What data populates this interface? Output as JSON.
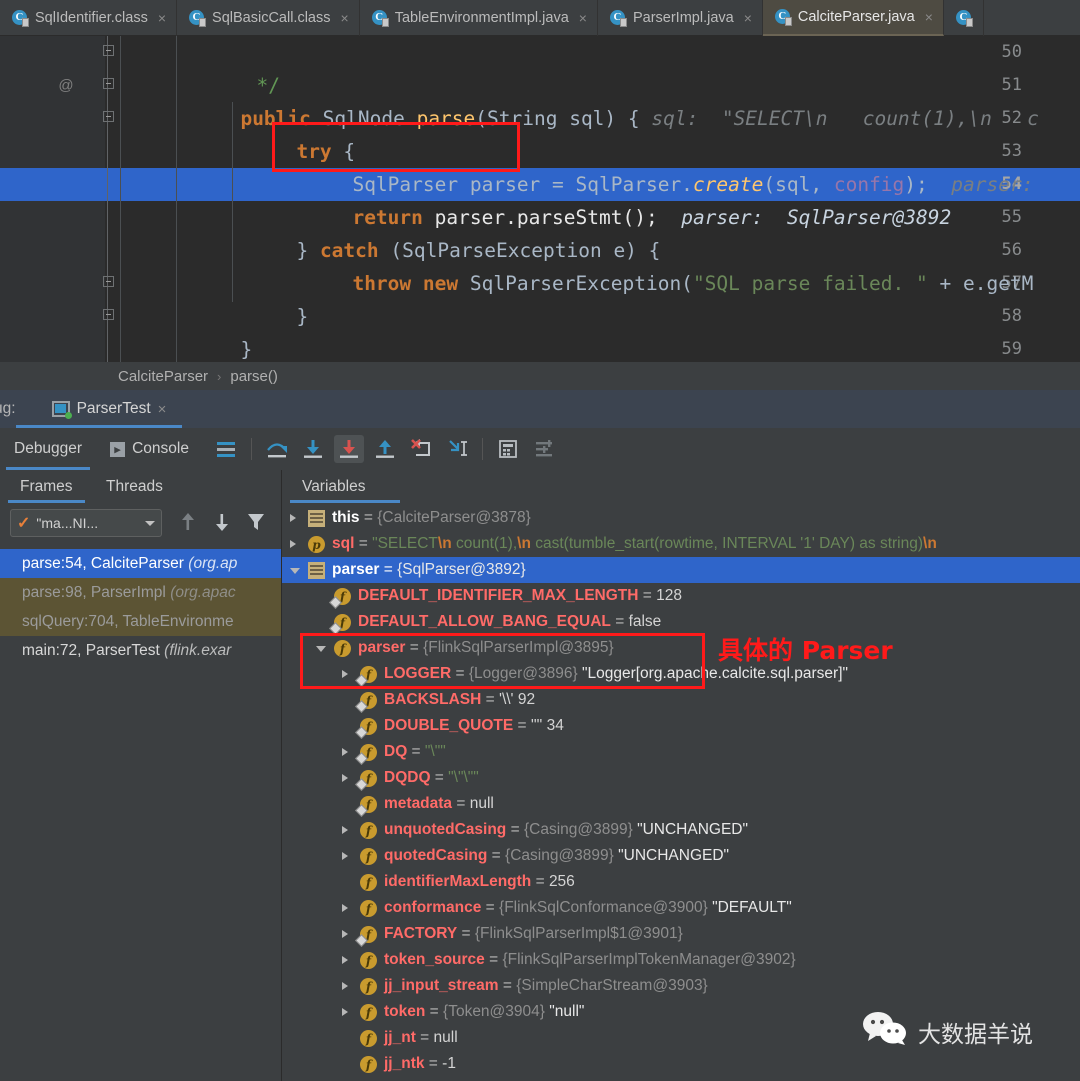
{
  "editor_tabs": [
    {
      "label": "SqlIdentifier.class",
      "icon": "java-class-icon",
      "active": false,
      "closable": true
    },
    {
      "label": "SqlBasicCall.class",
      "icon": "java-class-icon",
      "active": false,
      "closable": true
    },
    {
      "label": "TableEnvironmentImpl.java",
      "icon": "java-file-icon",
      "active": false,
      "closable": true
    },
    {
      "label": "ParserImpl.java",
      "icon": "java-file-icon",
      "active": false,
      "closable": true
    },
    {
      "label": "CalciteParser.java",
      "icon": "java-file-icon",
      "active": true,
      "closable": true
    }
  ],
  "close_glyph": "×",
  "code": {
    "lines": [
      {
        "number": "50",
        "annotation": "",
        "fold": true
      },
      {
        "number": "51",
        "annotation": "@",
        "fold": true
      },
      {
        "number": "52",
        "annotation": "",
        "fold": true
      },
      {
        "number": "53",
        "annotation": "",
        "fold": false
      },
      {
        "number": "54",
        "annotation": "",
        "fold": false,
        "current": true
      },
      {
        "number": "55",
        "annotation": "",
        "fold": false
      },
      {
        "number": "56",
        "annotation": "",
        "fold": false
      },
      {
        "number": "57",
        "annotation": "",
        "fold": true
      },
      {
        "number": "58",
        "annotation": "",
        "fold": true
      },
      {
        "number": "59",
        "annotation": "",
        "fold": false
      }
    ],
    "text": {
      "l50_comment": "*/",
      "l51_public": "public",
      "l51_type": " SqlNode ",
      "l51_method": "parse",
      "l51_sig": "(String sql) { ",
      "l51_hint": "sql:  \"SELECT\\n   count(1),\\n   c",
      "l52_try": "try",
      "l52_brace": " {",
      "l53_decl": "SqlParser parser ",
      "l53_eq": "= SqlParser.",
      "l53_create": "create",
      "l53_args_a": "(sql, ",
      "l53_config": "config",
      "l53_args_b": ");",
      "l53_hint": "parser:",
      "l54_return": "return",
      "l54_call": " parser.parseStmt();",
      "l54_hint": "parser:  SqlParser@3892",
      "l55_a": "} ",
      "l55_catch": "catch",
      "l55_b": " (SqlParseException e) {",
      "l56_throw": "throw",
      "l56_new": " new",
      "l56_cls": " SqlParserException(",
      "l56_str": "\"SQL parse failed. \"",
      "l56_tail": " + e.getM",
      "l57_close": "}",
      "l58_close": "}"
    }
  },
  "annotations": {
    "parser_label": "具体的 Parser",
    "box_color": "#ff1a1a"
  },
  "breadcrumb": {
    "class": "CalciteParser",
    "separator": "›",
    "method": "parse()"
  },
  "debug_header": {
    "label": "ug:",
    "run_config": "ParserTest",
    "close_glyph": "×"
  },
  "debug_toolbar": {
    "tabs": [
      {
        "label": "Debugger",
        "selected": true,
        "icon": null
      },
      {
        "label": "Console",
        "selected": false,
        "icon": "console-icon",
        "glyph": "▶"
      }
    ],
    "buttons": [
      {
        "name": "show-execution-point-icon",
        "active": false
      },
      {
        "name": "step-over-icon",
        "active": false
      },
      {
        "name": "step-into-icon",
        "active": false
      },
      {
        "name": "force-step-into-icon",
        "active": true
      },
      {
        "name": "step-out-icon",
        "active": false
      },
      {
        "name": "drop-frame-icon",
        "active": false
      },
      {
        "name": "run-to-cursor-icon",
        "active": false
      },
      {
        "name": "evaluate-expression-icon",
        "active": false
      },
      {
        "name": "settings-icon",
        "active": false
      }
    ]
  },
  "panel_tabs": {
    "frames": "Frames",
    "threads": "Threads",
    "variables": "Variables"
  },
  "frames_panel": {
    "thread_selector": {
      "value": "\"ma...NI...",
      "check": "✓"
    },
    "buttons": [
      "frame-up-icon",
      "frame-down-icon",
      "filter-icon"
    ],
    "rows": [
      {
        "text": "parse:54, CalciteParser ",
        "pkg": "(org.ap",
        "state": "sel"
      },
      {
        "text": "parse:98, ParserImpl ",
        "pkg": "(org.apac",
        "state": "lib"
      },
      {
        "text": "sqlQuery:704, TableEnvironme",
        "pkg": "",
        "state": "lib"
      },
      {
        "text": "main:72, ParserTest ",
        "pkg": "(flink.exar",
        "state": "usr"
      }
    ]
  },
  "variables": [
    {
      "indent": 0,
      "arrow": "closed",
      "icon": "object",
      "name": "this",
      "nclass": "n-o",
      "eq": "=",
      "value": "{CalciteParser@3878}",
      "vclass": "vref"
    },
    {
      "indent": 0,
      "arrow": "closed",
      "icon": "param",
      "glyph": "p",
      "name": "sql",
      "nclass": "n-p",
      "eq": "=",
      "value": "\"SELECT\\n  count(1),\\n  cast(tumble_start(rowtime, INTERVAL '1' DAY) as string)\\n",
      "vclass": "vstr",
      "escapes": true
    },
    {
      "indent": 0,
      "arrow": "open",
      "icon": "object",
      "name": "parser",
      "nclass": "n-o",
      "eq": "=",
      "value": "{SqlParser@3892}",
      "vclass": "vwhite",
      "selected": true
    },
    {
      "indent": 1,
      "arrow": "none",
      "icon": "field-static",
      "glyph": "f",
      "name": "DEFAULT_IDENTIFIER_MAX_LENGTH",
      "nclass": "n-f",
      "eq": "=",
      "value": "128",
      "vclass": "vnum"
    },
    {
      "indent": 1,
      "arrow": "none",
      "icon": "field-static",
      "glyph": "f",
      "name": "DEFAULT_ALLOW_BANG_EQUAL",
      "nclass": "n-f",
      "eq": "=",
      "value": "false",
      "vclass": "vnum"
    },
    {
      "indent": 1,
      "arrow": "open",
      "icon": "field",
      "glyph": "f",
      "name": "parser",
      "nclass": "n-f",
      "eq": "=",
      "value": "{FlinkSqlParserImpl@3895}",
      "vclass": "vref"
    },
    {
      "indent": 2,
      "arrow": "closed",
      "icon": "field-static",
      "glyph": "f",
      "name": "LOGGER",
      "nclass": "n-f",
      "eq": "=",
      "value": "{Logger@3896} ",
      "vclass": "vref",
      "value2": "\"Logger[org.apache.calcite.sql.parser]\"",
      "v2class": "vwhite"
    },
    {
      "indent": 2,
      "arrow": "none",
      "icon": "field-static",
      "glyph": "f",
      "name": "BACKSLASH",
      "nclass": "n-f",
      "eq": "=",
      "value": "'\\\\' 92",
      "vclass": "vnum"
    },
    {
      "indent": 2,
      "arrow": "none",
      "icon": "field-static",
      "glyph": "f",
      "name": "DOUBLE_QUOTE",
      "nclass": "n-f",
      "eq": "=",
      "value": "'\"' 34",
      "vclass": "vnum"
    },
    {
      "indent": 2,
      "arrow": "closed",
      "icon": "field-static",
      "glyph": "f",
      "name": "DQ",
      "nclass": "n-f",
      "eq": "=",
      "value": "\"\\\"\"",
      "vclass": "vstr"
    },
    {
      "indent": 2,
      "arrow": "closed",
      "icon": "field-static",
      "glyph": "f",
      "name": "DQDQ",
      "nclass": "n-f",
      "eq": "=",
      "value": "\"\\\"\\\"\"",
      "vclass": "vstr"
    },
    {
      "indent": 2,
      "arrow": "none",
      "icon": "field-static",
      "glyph": "f",
      "name": "metadata",
      "nclass": "n-f",
      "eq": "=",
      "value": "null",
      "vclass": "vplain"
    },
    {
      "indent": 2,
      "arrow": "closed",
      "icon": "field",
      "glyph": "f",
      "name": "unquotedCasing",
      "nclass": "n-f",
      "eq": "=",
      "value": "{Casing@3899} ",
      "vclass": "vref",
      "value2": "\"UNCHANGED\"",
      "v2class": "vwhite"
    },
    {
      "indent": 2,
      "arrow": "closed",
      "icon": "field",
      "glyph": "f",
      "name": "quotedCasing",
      "nclass": "n-f",
      "eq": "=",
      "value": "{Casing@3899} ",
      "vclass": "vref",
      "value2": "\"UNCHANGED\"",
      "v2class": "vwhite"
    },
    {
      "indent": 2,
      "arrow": "none",
      "icon": "field",
      "glyph": "f",
      "name": "identifierMaxLength",
      "nclass": "n-f",
      "eq": "=",
      "value": "256",
      "vclass": "vnum"
    },
    {
      "indent": 2,
      "arrow": "closed",
      "icon": "field",
      "glyph": "f",
      "name": "conformance",
      "nclass": "n-f",
      "eq": "=",
      "value": "{FlinkSqlConformance@3900} ",
      "vclass": "vref",
      "value2": "\"DEFAULT\"",
      "v2class": "vwhite"
    },
    {
      "indent": 2,
      "arrow": "closed",
      "icon": "field-static",
      "glyph": "f",
      "name": "FACTORY",
      "nclass": "n-f",
      "eq": "=",
      "value": "{FlinkSqlParserImpl$1@3901}",
      "vclass": "vref"
    },
    {
      "indent": 2,
      "arrow": "closed",
      "icon": "field",
      "glyph": "f",
      "name": "token_source",
      "nclass": "n-f",
      "eq": "=",
      "value": "{FlinkSqlParserImplTokenManager@3902}",
      "vclass": "vref"
    },
    {
      "indent": 2,
      "arrow": "closed",
      "icon": "field",
      "glyph": "f",
      "name": "jj_input_stream",
      "nclass": "n-f",
      "eq": "=",
      "value": "{SimpleCharStream@3903}",
      "vclass": "vref"
    },
    {
      "indent": 2,
      "arrow": "closed",
      "icon": "field",
      "glyph": "f",
      "name": "token",
      "nclass": "n-f",
      "eq": "=",
      "value": "{Token@3904} ",
      "vclass": "vref",
      "value2": "\"null\"",
      "v2class": "vwhite"
    },
    {
      "indent": 2,
      "arrow": "none",
      "icon": "field",
      "glyph": "f",
      "name": "jj_nt",
      "nclass": "n-f",
      "eq": "=",
      "value": "null",
      "vclass": "vplain"
    },
    {
      "indent": 2,
      "arrow": "none",
      "icon": "field",
      "glyph": "f",
      "name": "jj_ntk",
      "nclass": "n-f",
      "eq": "=",
      "value": "-1",
      "vclass": "vnum"
    }
  ],
  "watermark": {
    "text": "大数据羊说",
    "icon": "wechat-icon"
  }
}
